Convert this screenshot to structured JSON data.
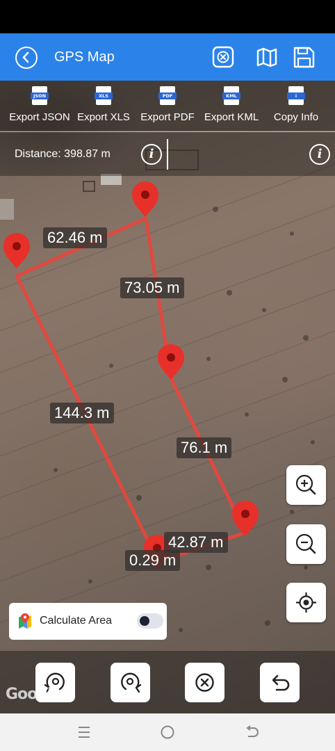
{
  "app": {
    "title": "GPS Map"
  },
  "header": {
    "back_icon": "back-circle-icon",
    "close_icon": "close-square-icon",
    "map_icon": "map-icon",
    "save_icon": "save-icon"
  },
  "export_bar": {
    "items": [
      {
        "label": "Export JSON",
        "tag": "JSON"
      },
      {
        "label": "Export XLS",
        "tag": "XLS"
      },
      {
        "label": "Export PDF",
        "tag": "PDF"
      },
      {
        "label": "Export KML",
        "tag": "KML"
      },
      {
        "label": "Copy Info",
        "tag": "i"
      }
    ]
  },
  "distance_bar": {
    "text": "Distance: 398.87 m",
    "info_glyph": "i"
  },
  "map": {
    "segment_labels": [
      "62.46 m",
      "73.05 m",
      "144.3 m",
      "76.1 m",
      "42.87 m",
      "0.29 m"
    ],
    "line_color": "#e8453c",
    "marker_color": "#e8302a"
  },
  "calculate_area": {
    "label": "Calculate Area",
    "enabled": false
  },
  "attribution": "Google",
  "colors": {
    "primary": "#2b83e9"
  }
}
